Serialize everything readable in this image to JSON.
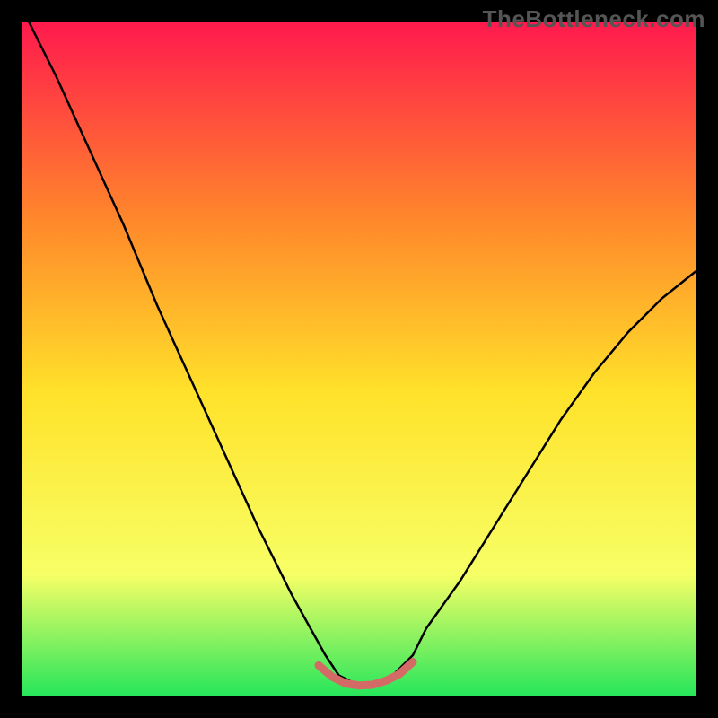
{
  "watermark": "TheBottleneck.com",
  "chart_data": {
    "type": "line",
    "title": "",
    "xlabel": "",
    "ylabel": "",
    "xlim": [
      0,
      100
    ],
    "ylim": [
      0,
      100
    ],
    "grid": false,
    "axes_visible": false,
    "background_gradient": {
      "top_color": "#ff1a4d",
      "upper_mid_color": "#ff8a2a",
      "mid_color": "#ffe22a",
      "lower_mid_color": "#f7ff66",
      "bottom_color": "#27e65b"
    },
    "series": [
      {
        "name": "bottleneck-curve",
        "stroke": "#000000",
        "stroke_width": 2.5,
        "x": [
          0,
          5,
          10,
          15,
          20,
          25,
          30,
          35,
          40,
          45,
          47,
          50,
          53,
          55,
          58,
          60,
          65,
          70,
          75,
          80,
          85,
          90,
          95,
          100
        ],
        "y": [
          102,
          92,
          81,
          70,
          58,
          47,
          36,
          25,
          15,
          6,
          3,
          1.5,
          1.5,
          3,
          6,
          10,
          17,
          25,
          33,
          41,
          48,
          54,
          59,
          63
        ]
      },
      {
        "name": "valley-highlight",
        "stroke": "#d46a66",
        "stroke_width": 9,
        "x": [
          44,
          46,
          48,
          50,
          52,
          54,
          56,
          58
        ],
        "y": [
          4.5,
          2.8,
          1.8,
          1.5,
          1.6,
          2.2,
          3.2,
          5.0
        ]
      }
    ]
  }
}
